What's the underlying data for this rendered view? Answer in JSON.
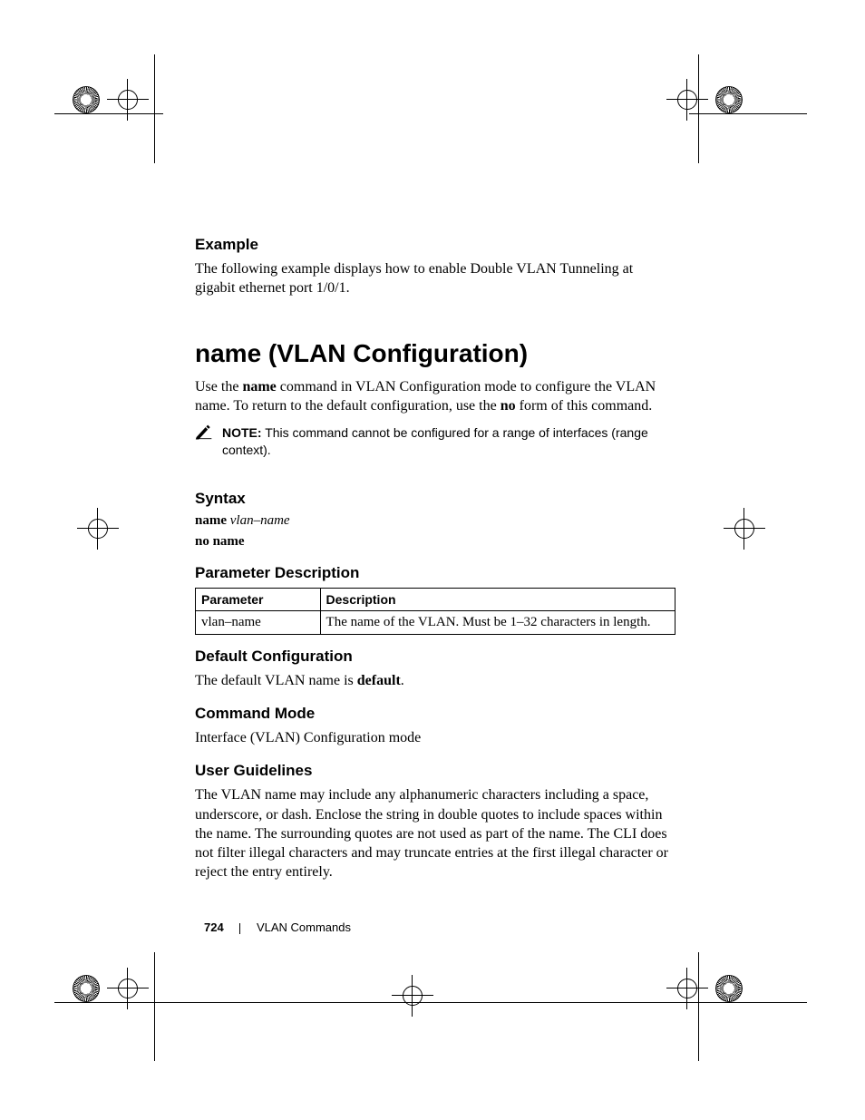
{
  "section_example": {
    "heading": "Example",
    "body": "The following example displays how to enable Double VLAN Tunneling at gigabit ethernet port 1/0/1."
  },
  "command": {
    "title": "name (VLAN Configuration)",
    "intro_pre": "Use the ",
    "intro_bold1": "name",
    "intro_mid": " command in VLAN Configuration mode to configure the VLAN name. To return to the default configuration, use the ",
    "intro_bold2": "no",
    "intro_post": " form of this command."
  },
  "note": {
    "label": "NOTE:",
    "text": " This command cannot be configured for a range of interfaces (range context)."
  },
  "syntax": {
    "heading": "Syntax",
    "line1_bold": "name",
    "line1_italic": " vlan–name",
    "line2": "no name"
  },
  "param_desc": {
    "heading": "Parameter Description",
    "table": {
      "headers": {
        "c1": "Parameter",
        "c2": "Description"
      },
      "rows": [
        {
          "param": "vlan–name",
          "desc": "The name of the VLAN. Must be 1–32 characters in length."
        }
      ]
    }
  },
  "default_cfg": {
    "heading": "Default Configuration",
    "body_pre": "The default VLAN name is ",
    "body_bold": "default",
    "body_post": "."
  },
  "cmd_mode": {
    "heading": "Command Mode",
    "body": "Interface (VLAN) Configuration mode"
  },
  "user_guidelines": {
    "heading": "User Guidelines",
    "body": "The VLAN name may include any alphanumeric characters including a space, underscore, or dash. Enclose the string in double quotes to include spaces within the name. The surrounding quotes are not used as part of the name. The CLI does not filter illegal characters and may truncate entries at the first illegal character or reject the entry entirely."
  },
  "footer": {
    "page_number": "724",
    "section": "VLAN Commands"
  }
}
